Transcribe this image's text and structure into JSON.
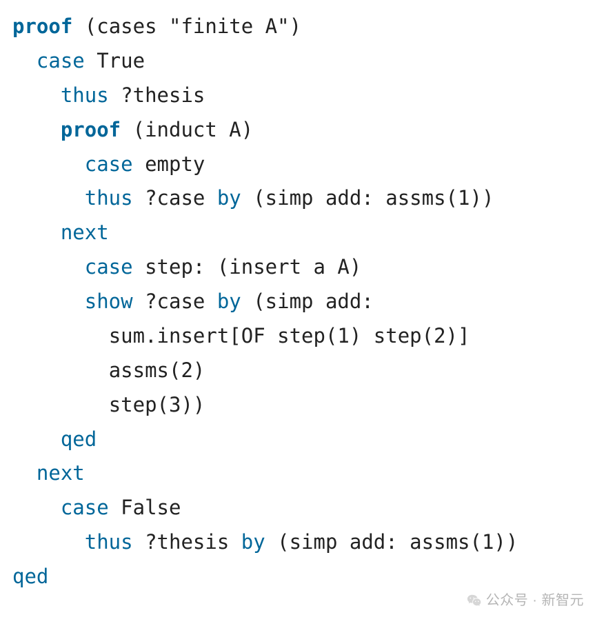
{
  "code": {
    "lines": [
      {
        "indent": 0,
        "tokens": [
          {
            "t": "proof",
            "c": "kw-bold"
          },
          {
            "t": " (cases \"finite A\")",
            "c": "txt"
          }
        ]
      },
      {
        "indent": 1,
        "tokens": [
          {
            "t": "case",
            "c": "kw"
          },
          {
            "t": " True",
            "c": "txt"
          }
        ]
      },
      {
        "indent": 2,
        "tokens": [
          {
            "t": "thus",
            "c": "kw"
          },
          {
            "t": " ?thesis",
            "c": "txt"
          }
        ]
      },
      {
        "indent": 2,
        "tokens": [
          {
            "t": "proof",
            "c": "kw-bold"
          },
          {
            "t": " (induct A)",
            "c": "txt"
          }
        ]
      },
      {
        "indent": 3,
        "tokens": [
          {
            "t": "case",
            "c": "kw"
          },
          {
            "t": " empty",
            "c": "txt"
          }
        ]
      },
      {
        "indent": 3,
        "tokens": [
          {
            "t": "thus",
            "c": "kw"
          },
          {
            "t": " ?case ",
            "c": "txt"
          },
          {
            "t": "by",
            "c": "kw"
          },
          {
            "t": " (simp add: assms(1))",
            "c": "txt"
          }
        ]
      },
      {
        "indent": 2,
        "tokens": [
          {
            "t": "next",
            "c": "kw"
          }
        ]
      },
      {
        "indent": 3,
        "tokens": [
          {
            "t": "case",
            "c": "kw"
          },
          {
            "t": " step: (insert a A)",
            "c": "txt"
          }
        ]
      },
      {
        "indent": 3,
        "tokens": [
          {
            "t": "show",
            "c": "kw"
          },
          {
            "t": " ?case ",
            "c": "txt"
          },
          {
            "t": "by",
            "c": "kw"
          },
          {
            "t": " (simp add:",
            "c": "txt"
          }
        ]
      },
      {
        "indent": 4,
        "tokens": [
          {
            "t": "sum.insert[OF step(1) step(2)]",
            "c": "txt"
          }
        ]
      },
      {
        "indent": 4,
        "tokens": [
          {
            "t": "assms(2)",
            "c": "txt"
          }
        ]
      },
      {
        "indent": 4,
        "tokens": [
          {
            "t": "step(3))",
            "c": "txt"
          }
        ]
      },
      {
        "indent": 2,
        "tokens": [
          {
            "t": "qed",
            "c": "kw"
          }
        ]
      },
      {
        "indent": 1,
        "tokens": [
          {
            "t": "next",
            "c": "kw"
          }
        ]
      },
      {
        "indent": 2,
        "tokens": [
          {
            "t": "case",
            "c": "kw"
          },
          {
            "t": " False",
            "c": "txt"
          }
        ]
      },
      {
        "indent": 3,
        "tokens": [
          {
            "t": "thus",
            "c": "kw"
          },
          {
            "t": " ?thesis ",
            "c": "txt"
          },
          {
            "t": "by",
            "c": "kw"
          },
          {
            "t": " (simp add: assms(1))",
            "c": "txt"
          }
        ]
      },
      {
        "indent": 0,
        "tokens": [
          {
            "t": "qed",
            "c": "kw"
          }
        ]
      }
    ],
    "indent_unit": "  "
  },
  "watermark": {
    "text": "公众号 · 新智元"
  }
}
